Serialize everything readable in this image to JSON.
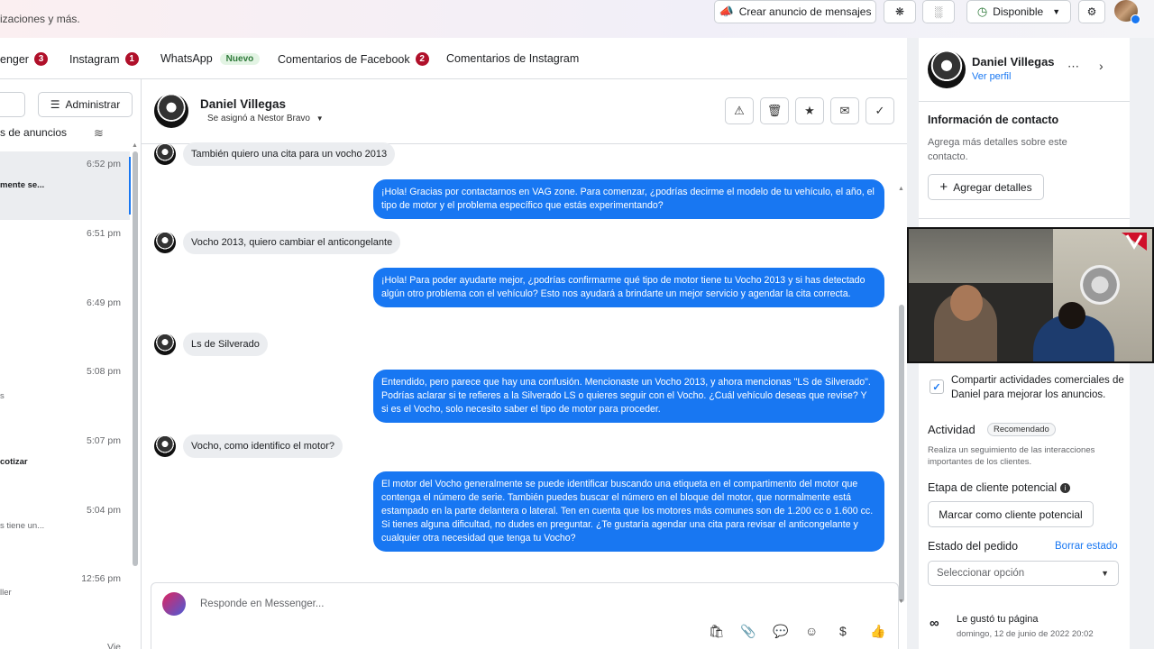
{
  "topbar": {
    "subtitle_fragment": "izaciones y más.",
    "create_ad_label": "Crear anuncio de mensajes",
    "status_label": "Disponible"
  },
  "tabs": [
    {
      "label": "enger",
      "count": "3"
    },
    {
      "label": "Instagram",
      "count": "1"
    },
    {
      "label": "WhatsApp",
      "tag": "Nuevo"
    },
    {
      "label": "Comentarios de Facebook",
      "count": "2"
    },
    {
      "label": "Comentarios de Instagram"
    }
  ],
  "left_list": {
    "admin_label": "Administrar",
    "ads_filter_label": "s de anuncios",
    "items": [
      {
        "time": "6:52 pm",
        "snippet": "mente se...",
        "style": "bold"
      },
      {
        "time": "6:51 pm",
        "snippet": ""
      },
      {
        "time": "6:49 pm",
        "snippet": ""
      },
      {
        "time": "5:08 pm",
        "snippet": "s"
      },
      {
        "time": "5:07 pm",
        "snippet": "cotizar",
        "style": "bold"
      },
      {
        "time": "5:04 pm",
        "snippet": "s tiene un...",
        "style": "grey"
      },
      {
        "time": "12:56 pm",
        "snippet": "ller",
        "style": "grey"
      },
      {
        "time": "Vie",
        "snippet": ""
      }
    ]
  },
  "chat": {
    "contact_name": "Daniel Villegas",
    "assigned_to": "Se asignó a Nestor Bravo",
    "messages": [
      {
        "dir": "in",
        "text": "También quiero una cita para un vocho 2013"
      },
      {
        "dir": "out",
        "text": "¡Hola! Gracias por contactarnos en VAG zone. Para comenzar, ¿podrías decirme el modelo de tu vehículo, el año, el tipo de motor y el problema específico que estás experimentando?"
      },
      {
        "dir": "in",
        "text": "Vocho 2013, quiero cambiar el anticongelante"
      },
      {
        "dir": "out",
        "text": "¡Hola! Para poder ayudarte mejor, ¿podrías confirmarme qué tipo de motor tiene tu Vocho 2013 y si has detectado algún otro problema con el vehículo? Esto nos ayudará a brindarte un mejor servicio y agendar la cita correcta."
      },
      {
        "dir": "in",
        "text": "Ls de Silverado"
      },
      {
        "dir": "out",
        "text": "Entendido, pero parece que hay una confusión. Mencionaste un Vocho 2013, y ahora mencionas \"LS de Silverado\". Podrías aclarar si te refieres a la Silverado LS o quieres seguir con el Vocho. ¿Cuál vehículo deseas que revise? Y si es el Vocho, solo necesito saber el tipo de motor para proceder."
      },
      {
        "dir": "in",
        "text": "Vocho, como identifico el motor?"
      },
      {
        "dir": "out",
        "text": "El motor del Vocho generalmente se puede identificar buscando una etiqueta en el compartimento del motor que contenga el número de serie. También puedes buscar el número en el bloque del motor, que normalmente está estampado en la parte delantera o lateral. Ten en cuenta que los motores más comunes son de 1.200 cc o 1.600 cc. Si tienes alguna dificultad, no dudes en preguntar. ¿Te gustaría agendar una cita para revisar el anticongelante y cualquier otra necesidad que tenga tu Vocho?"
      }
    ],
    "composer_placeholder": "Responde en Messenger..."
  },
  "sidebar": {
    "name": "Daniel Villegas",
    "profile_link": "Ver perfil",
    "contact_title": "Información de contacto",
    "contact_desc": "Agrega más detalles sobre este contacto.",
    "add_details_label": "Agregar detalles",
    "share_text": "Compartir actividades comerciales de Daniel para mejorar los anuncios.",
    "activity_title": "Actividad",
    "activity_badge": "Recomendado",
    "activity_desc": "Realiza un seguimiento de las interacciones importantes de los clientes.",
    "lead_stage_title": "Etapa de cliente potencial",
    "mark_lead_label": "Marcar como cliente potencial",
    "order_status_title": "Estado del pedido",
    "clear_status_label": "Borrar estado",
    "select_placeholder": "Seleccionar opción",
    "liked_page": "Le gustó tu página",
    "liked_date": "domingo, 12 de junio de 2022 20:02"
  },
  "colors": {
    "primary_blue": "#1877f2",
    "badge_red": "#b0102a",
    "badge_green_bg": "#e3f4e4"
  }
}
